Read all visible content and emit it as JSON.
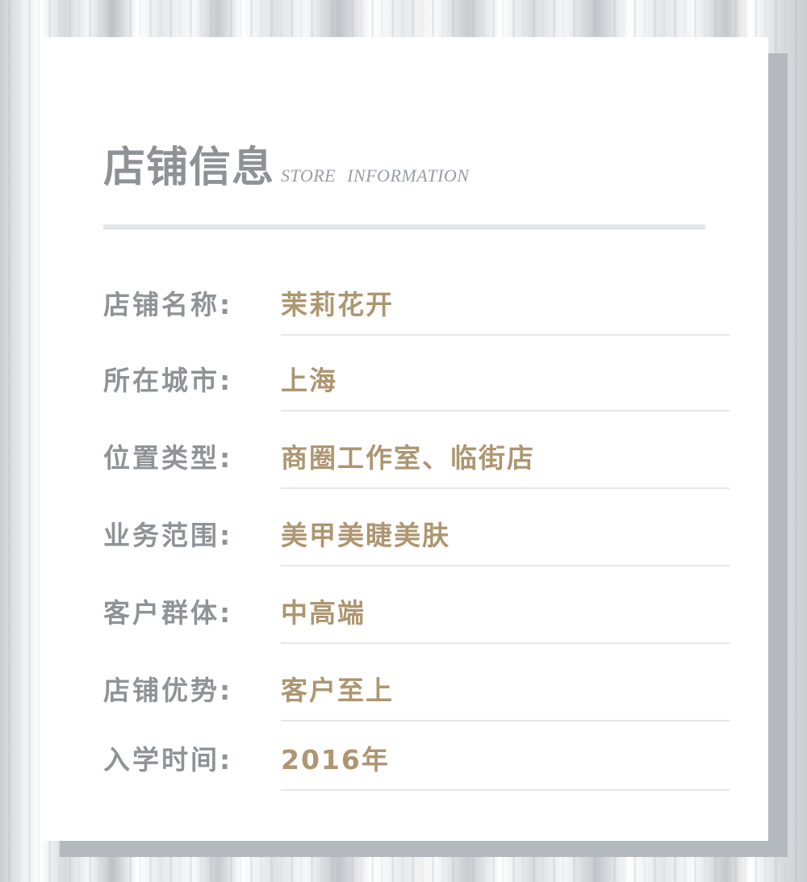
{
  "header": {
    "title_cn": "店铺信息",
    "title_en": "STORE INFORMATION"
  },
  "rows": [
    {
      "label": "店铺名称:",
      "value": "茉莉花开"
    },
    {
      "label": "所在城市:",
      "value": "上海"
    },
    {
      "label": "位置类型:",
      "value": "商圈工作室、临街店"
    },
    {
      "label": "业务范围:",
      "value": "美甲美睫美肤"
    },
    {
      "label": "客户群体:",
      "value": "中高端"
    },
    {
      "label": "店铺优势:",
      "value": "客户至上"
    },
    {
      "label": "入学时间:",
      "value": "2016年"
    }
  ],
  "colors": {
    "label": "#8f9398",
    "value": "#ad9670",
    "title": "#8e9297",
    "card": "#ffffff",
    "card_shadow": "#b4b9bf"
  }
}
